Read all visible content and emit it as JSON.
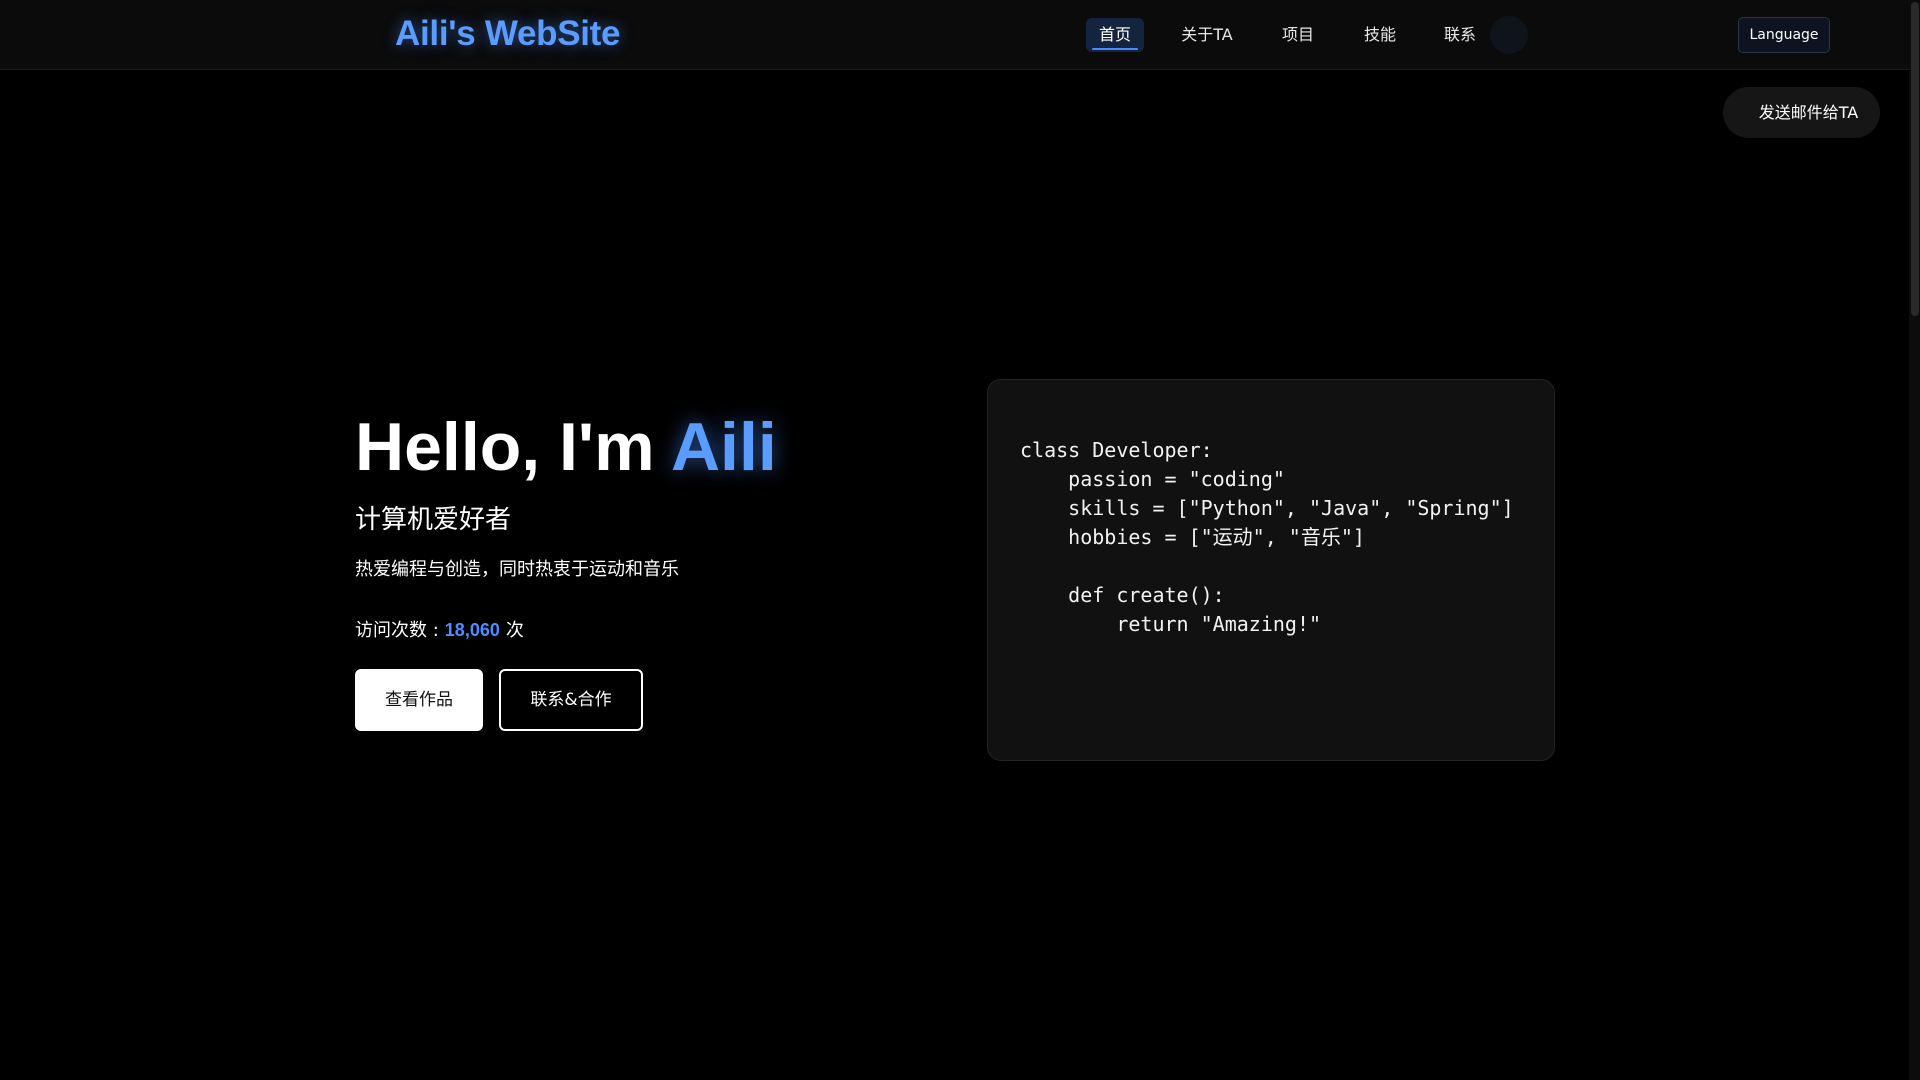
{
  "header": {
    "logo": "Aili's WebSite",
    "nav": [
      {
        "label": "首页",
        "active": true
      },
      {
        "label": "关于TA",
        "active": false
      },
      {
        "label": "项目",
        "active": false
      },
      {
        "label": "技能",
        "active": false
      },
      {
        "label": "联系",
        "active": false
      }
    ],
    "language_label": "Language"
  },
  "floating": {
    "mail_button_label": "发送邮件给TA"
  },
  "hero": {
    "greeting": "Hello, I'm ",
    "name": "Aili",
    "subtitle": "计算机爱好者",
    "description": "热爱编程与创造，同时热衷于运动和音乐",
    "visits": {
      "label": "访问次数 :",
      "count": "18,060",
      "unit": "次"
    },
    "buttons": {
      "primary": "查看作品",
      "secondary": "联系&合作"
    }
  },
  "code_card": {
    "lines": [
      "class Developer:",
      "    passion = \"coding\"",
      "    skills = [\"Python\", \"Java\", \"Spring\"]",
      "    hobbies = [\"运动\", \"音乐\"]",
      "",
      "    def create():",
      "        return \"Amazing!\""
    ]
  },
  "colors": {
    "accent": "#5a9cff",
    "background": "#000000",
    "navbar": "#0b0b0b",
    "card": "#111111"
  }
}
